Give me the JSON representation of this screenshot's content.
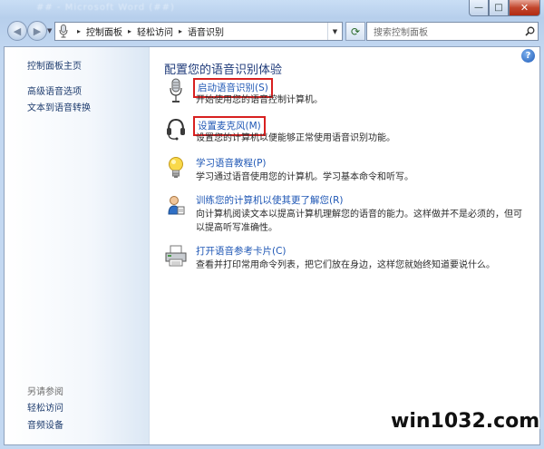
{
  "window": {
    "title": "## - Microsoft Word (##)",
    "minimize_label": "—",
    "maximize_label": "□",
    "close_label": "✕"
  },
  "nav": {
    "back_label": "◀",
    "forward_label": "▶",
    "dropdown_label": "▼",
    "refresh_label": "⟳"
  },
  "address": {
    "icon": "microphone-icon",
    "breadcrumb": [
      {
        "label": "控制面板"
      },
      {
        "label": "轻松访问"
      },
      {
        "label": "语音识别"
      }
    ],
    "separator": "▸",
    "item_dropdown": "▼",
    "dropdown": "▼"
  },
  "search": {
    "placeholder": "搜索控制面板"
  },
  "sidebar": {
    "home": "控制面板主页",
    "links": [
      "高级语音选项",
      "文本到语音转换"
    ],
    "see_also_title": "另请参阅",
    "see_also": [
      "轻松访问",
      "音频设备"
    ]
  },
  "main": {
    "heading": "配置您的语音识别体验",
    "help_label": "?",
    "items": [
      {
        "icon": "microphone-icon",
        "link": "启动语音识别(S)",
        "desc": "开始使用您的语音控制计算机。",
        "highlighted": true
      },
      {
        "icon": "headset-icon",
        "link": "设置麦克风(M)",
        "desc": "设置您的计算机以便能够正常使用语音识别功能。",
        "highlighted": true
      },
      {
        "icon": "lightbulb-icon",
        "link": "学习语音教程(P)",
        "desc": "学习通过语音使用您的计算机。学习基本命令和听写。",
        "highlighted": false
      },
      {
        "icon": "user-training-icon",
        "link": "训练您的计算机以使其更了解您(R)",
        "desc": "向计算机阅读文本以提高计算机理解您的语音的能力。这样做并不是必须的，但可以提高听写准确性。",
        "highlighted": false
      },
      {
        "icon": "printer-icon",
        "link": "打开语音参考卡片(C)",
        "desc": "查看并打印常用命令列表，把它们放在身边，这样您就始终知道要说什么。",
        "highlighted": false
      }
    ]
  },
  "watermark": "win1032.com",
  "colors": {
    "link": "#1f57b5",
    "heading": "#1e3a79",
    "highlight": "#d82020"
  }
}
